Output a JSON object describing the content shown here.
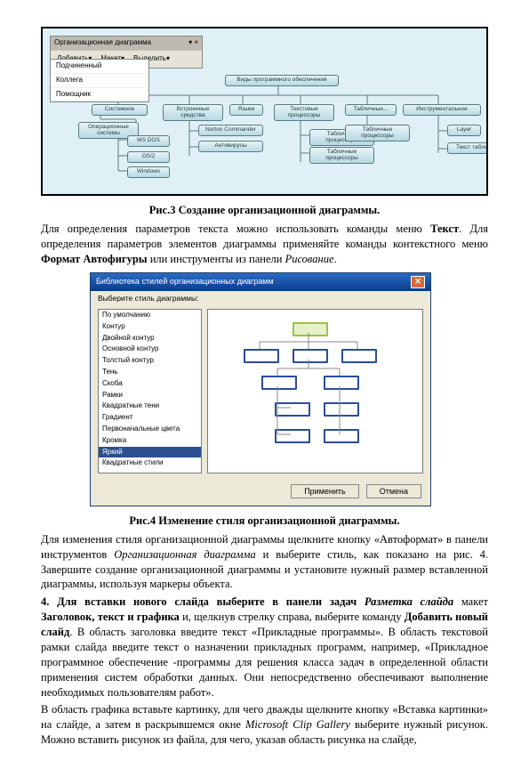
{
  "fig1": {
    "toolbar_title": "Организационная диаграмма",
    "toolbar_close": "▾ ×",
    "tb_items": [
      "Добавить▾",
      "Макет▾",
      "Выделить▾"
    ],
    "dd_options": [
      "Подчиненный",
      "Коллега",
      "Помощник"
    ],
    "nodes": {
      "root": "Виды программного обеспечения",
      "a": "Системное",
      "b": "Встроенные средства",
      "c": "Языки",
      "d": "Текстовые процессоры",
      "e": "Табличные...",
      "f": "Инструментальное",
      "g": "Операционные системы",
      "g1": "MS DOS",
      "g2": "OS/2",
      "g3": "Windows",
      "h1": "Norton Commander",
      "h2": "Антивирусы",
      "i1": "Табличные процессоры",
      "i2": "Табличные процессоры",
      "j": "Табличные процессоры",
      "k1": "Layer",
      "k2": "Текст таблица"
    },
    "caption": "Рис.3 Создание организационной диаграммы."
  },
  "para1": {
    "t1": "Для определения параметров текста можно использовать команды меню ",
    "t2": "Текст",
    "t3": ". Для определения параметров элементов диаграммы применяйте команды контекстного меню ",
    "t4": "Формат Автофигуры",
    "t5": " или инструменты из панели ",
    "t6": "Рисование",
    "t7": "."
  },
  "fig2": {
    "title": "Библиотека стилей организационных диаграмм",
    "subcap": "Выберите стиль диаграммы:",
    "items": [
      "По умолчанию",
      "Контур",
      "Двойной контур",
      "Основной контур",
      "Толстый контур",
      "Тень",
      "Скоба",
      "Рамки",
      "Квадратные тени",
      "Градиент",
      "Первоначальные цвета",
      "Кромка",
      "Яркий",
      "Квадратные стили"
    ],
    "ok": "Применить",
    "cancel": "Отмена",
    "caption": "Рис.4 Изменение стиля организационной диаграммы."
  },
  "para2": {
    "t1": "Для изменения стиля организационной диаграммы щелкните кнопку «Автоформат» в панели инструментов ",
    "t2": "Организационная диаграмма",
    "t3": " и выберите стиль, как показано на рис. 4. Завершите создание организационной диаграммы и установите нужный размер вставленной диаграммы, используя маркеры объекта."
  },
  "para3": {
    "t1": "4. Для вставки нового слайда выберите в панели задач ",
    "t2": "Разметка слайда",
    "t3": " макет ",
    "t4": "Заголовок, текст и графика",
    "t5": " и, щелкнув стрелку справа, выберите команду ",
    "t6": "Добавить новый слайд",
    "t7": ". В область заголовка введите текст «Прикладные программы». В область текстовой рамки слайда введите текст о назначении прикладных программ, например, «Прикладное программное обеспечение -программы для решения класса задач в определенной области применения систем обработки данных. Они непосредственно обеспечивают выполнение необходимых пользователям работ»."
  },
  "para4": {
    "t1": "В область графика вставьте картинку, для чего дважды щелкните кнопку «Вставка картинки» на слайде, а затем в раскрывшемся окне ",
    "t2": "Microsoft Clip Gallery",
    "t3": " выберите нужный рисунок. Можно вставить рисунок из файла, для чего, указав область рисунка на слайде,"
  }
}
